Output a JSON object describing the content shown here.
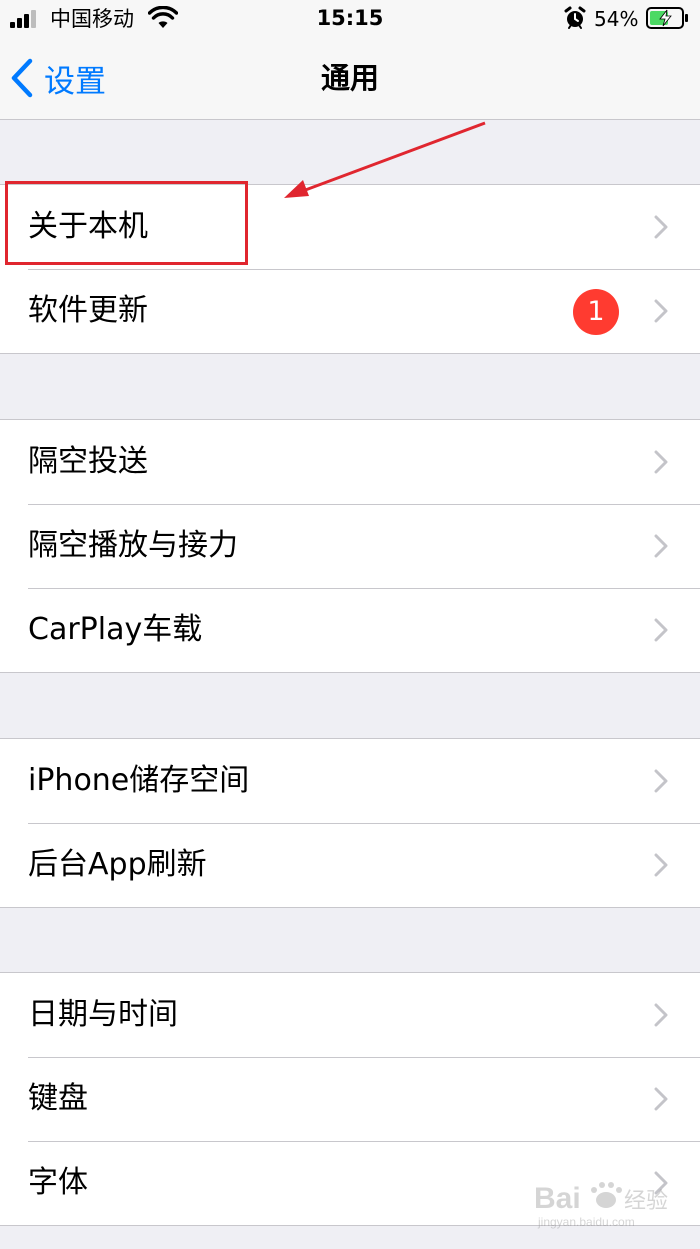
{
  "status_bar": {
    "carrier": "中国移动",
    "time": "15:15",
    "battery_percent": "54%",
    "icons": [
      "signal-icon",
      "wifi-icon",
      "alarm-icon",
      "battery-charging-icon"
    ]
  },
  "nav": {
    "back_label": "设置",
    "title": "通用"
  },
  "groups": [
    {
      "items": [
        {
          "label": "关于本机"
        },
        {
          "label": "软件更新",
          "badge": "1"
        }
      ]
    },
    {
      "items": [
        {
          "label": "隔空投送"
        },
        {
          "label": "隔空播放与接力"
        },
        {
          "label": "CarPlay车载"
        }
      ]
    },
    {
      "items": [
        {
          "label": "iPhone储存空间"
        },
        {
          "label": "后台App刷新"
        }
      ]
    },
    {
      "items": [
        {
          "label": "日期与时间"
        },
        {
          "label": "键盘"
        },
        {
          "label": "字体"
        }
      ]
    }
  ],
  "colors": {
    "accent": "#007aff",
    "badge": "#ff3b30",
    "annotation": "#e0262f",
    "separator": "#c8c7cc",
    "background": "#efeff4"
  },
  "watermark": {
    "brand": "Bai",
    "brand_cn": "经验",
    "url": "jingyan.baidu.com"
  }
}
